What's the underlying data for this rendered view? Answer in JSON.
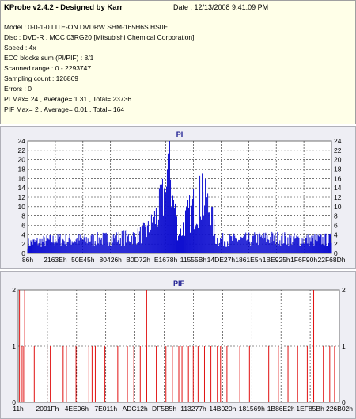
{
  "info": {
    "title": "KProbe v2.4.2 - Designed by Karr",
    "date": "Date : 12/13/2008 9:41:09 PM",
    "lines": [
      "Model : 0-0-1-0 LITE-ON DVDRW SHM-165H6S HS0E",
      "Disc : DVD-R , MCC 03RG20  [Mitsubishi Chemical Corporation]",
      "Speed : 4x",
      "ECC blocks sum (PI/PIF) : 8/1",
      "Scanned range : 0 - 2293747",
      "Sampling count : 126869",
      "Errors : 0",
      "PI Max= 24 , Average= 1.31 , Total= 23736",
      "PIF Max= 2 , Average= 0.01 , Total= 164"
    ]
  },
  "colors": {
    "series": "#1010d0",
    "pif_series": "#e01010",
    "background": "#eeeef4",
    "info_bg": "#ffffe8"
  },
  "chart_data": [
    {
      "type": "bar",
      "title": "PI",
      "ylim": [
        0,
        24
      ],
      "yticks": [
        0,
        2,
        4,
        6,
        8,
        10,
        12,
        14,
        16,
        18,
        20,
        22,
        24
      ],
      "xticks": [
        "86h",
        "2163Eh",
        "50E45h",
        "80426h",
        "B0D72h",
        "E1678h",
        "11555Bh",
        "14DE27h",
        "1861E5h",
        "1BE925h",
        "1F6F90h",
        "22F68Dh"
      ],
      "grid": true,
      "envelope": [
        [
          0,
          3
        ],
        [
          0.04,
          3.5
        ],
        [
          0.1,
          4
        ],
        [
          0.2,
          4
        ],
        [
          0.3,
          4.5
        ],
        [
          0.36,
          5
        ],
        [
          0.4,
          7
        ],
        [
          0.43,
          12
        ],
        [
          0.455,
          18
        ],
        [
          0.465,
          21
        ],
        [
          0.47,
          23
        ],
        [
          0.48,
          15
        ],
        [
          0.49,
          9
        ],
        [
          0.5,
          5
        ],
        [
          0.52,
          10
        ],
        [
          0.55,
          14
        ],
        [
          0.57,
          16
        ],
        [
          0.6,
          13
        ],
        [
          0.62,
          4
        ],
        [
          0.7,
          4
        ],
        [
          0.8,
          4.5
        ],
        [
          0.9,
          4
        ],
        [
          1,
          4
        ]
      ],
      "peaks": [
        [
          0.468,
          24
        ],
        [
          0.575,
          17
        ]
      ]
    },
    {
      "type": "bar",
      "title": "PIF",
      "ylim": [
        0,
        2
      ],
      "yticks": [
        0,
        1,
        2
      ],
      "xticks": [
        "11h",
        "2091Fh",
        "4EE06h",
        "7E011h",
        "ADC12h",
        "DF5B5h",
        "113277h",
        "14B020h",
        "181569h",
        "1B86E2h",
        "1EF85Bh",
        "226B02h"
      ],
      "grid": true,
      "spikes_1": [
        0.01,
        0.015,
        0.05,
        0.09,
        0.1,
        0.14,
        0.15,
        0.18,
        0.22,
        0.23,
        0.24,
        0.27,
        0.31,
        0.34,
        0.36,
        0.38,
        0.4,
        0.43,
        0.46,
        0.48,
        0.5,
        0.51,
        0.53,
        0.545,
        0.56,
        0.58,
        0.6,
        0.62,
        0.63,
        0.65,
        0.69,
        0.72,
        0.75,
        0.78,
        0.81,
        0.84,
        0.87,
        0.9,
        0.92,
        0.95,
        0.97,
        0.985
      ],
      "spikes_2": [
        0.004,
        0.02,
        0.4,
        0.92
      ]
    }
  ]
}
